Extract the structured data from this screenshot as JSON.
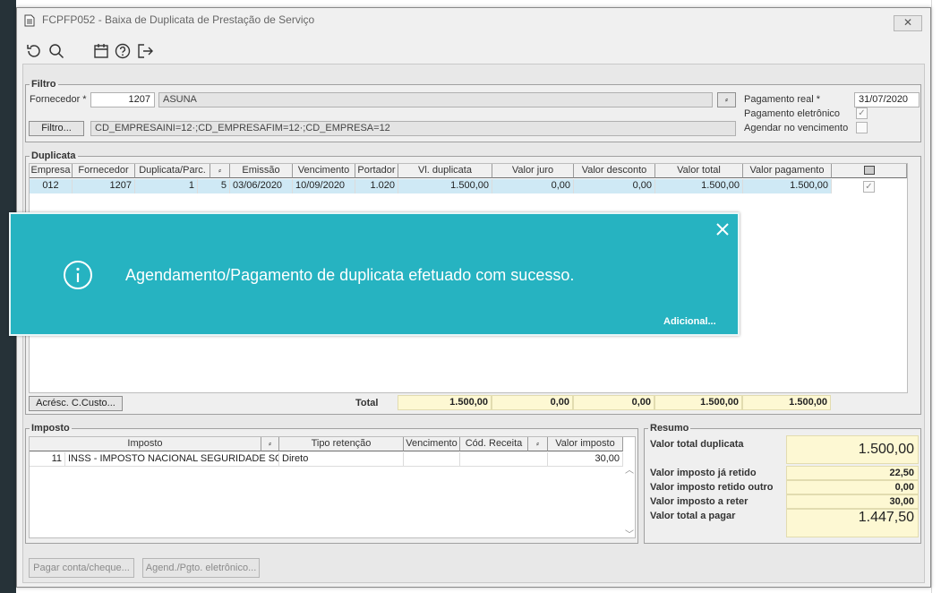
{
  "window": {
    "title": "FCPFP052 - Baixa de Duplicata de Prestação de Serviço",
    "close_label": "✕"
  },
  "toolbar": {
    "icons": [
      "refresh-icon",
      "search-icon",
      "calendar-icon",
      "help-icon",
      "exit-icon"
    ]
  },
  "filtro": {
    "legend": "Filtro",
    "fornecedor_label": "Fornecedor *",
    "fornecedor_code": "1207",
    "fornecedor_name": "ASUNA",
    "lookup_label": "⸗",
    "filtro_button": "Filtro...",
    "filtro_value": "CD_EMPRESAINI=12·;CD_EMPRESAFIM=12·;CD_EMPRESA=12",
    "pagamento_real_label": "Pagamento real *",
    "pagamento_real_value": "31/07/2020",
    "pagamento_eletronico_label": "Pagamento eletrônico",
    "pagamento_eletronico_checked": true,
    "agendar_label": "Agendar no vencimento",
    "agendar_checked": false
  },
  "duplicata": {
    "legend": "Duplicata",
    "columns": [
      "Empresa",
      "Fornecedor",
      "Duplicata/Parc.",
      "⸗",
      "Emissão",
      "Vencimento",
      "Portador",
      "Vl. duplicata",
      "Valor juro",
      "Valor desconto",
      "Valor total",
      "Valor pagamento"
    ],
    "rows": [
      {
        "empresa": "012",
        "fornecedor": "1207",
        "duplicata": "1",
        "parcela": "5",
        "emissao": "03/06/2020",
        "vencimento": "10/09/2020",
        "portador": "1.020",
        "vl_duplicata": "1.500,00",
        "valor_juro": "0,00",
        "valor_desconto": "0,00",
        "valor_total": "1.500,00",
        "valor_pagamento": "1.500,00"
      }
    ],
    "acresc_button": "Acrésc. C.Custo...",
    "total_label": "Total",
    "totals": {
      "vl_duplicata": "1.500,00",
      "valor_juro": "0,00",
      "valor_desconto": "0,00",
      "valor_total": "1.500,00",
      "valor_pagamento": "1.500,00"
    }
  },
  "imposto": {
    "legend": "Imposto",
    "columns": [
      "Imposto",
      "⸗",
      "Tipo retenção",
      "Vencimento",
      "Cód. Receita",
      "⸗",
      "Valor imposto"
    ],
    "rows": [
      {
        "codigo": "11",
        "nome": "INSS - IMPOSTO NACIONAL SEGURIDADE SOCIAL",
        "tipo_retencao": "Direto",
        "vencimento": "",
        "cod_receita": "",
        "valor_imposto": "30,00"
      }
    ]
  },
  "resumo": {
    "legend": "Resumo",
    "valor_total_duplicata_label": "Valor total duplicata",
    "valor_total_duplicata": "1.500,00",
    "imposto_ja_retido_label": "Valor imposto já retido",
    "imposto_ja_retido": "22,50",
    "imposto_retido_outro_label": "Valor imposto retido outro",
    "imposto_retido_outro": "0,00",
    "imposto_a_reter_label": "Valor imposto a reter",
    "imposto_a_reter": "30,00",
    "valor_total_pagar_label": "Valor total a pagar",
    "valor_total_pagar": "1.447,50"
  },
  "footer": {
    "pagar_button": "Pagar conta/cheque...",
    "agend_button": "Agend./Pgto. eletrônico..."
  },
  "toast": {
    "message": "Agendamento/Pagamento de duplicata efetuado com sucesso.",
    "more_link": "Adicional...",
    "color": "#26b3c1"
  }
}
